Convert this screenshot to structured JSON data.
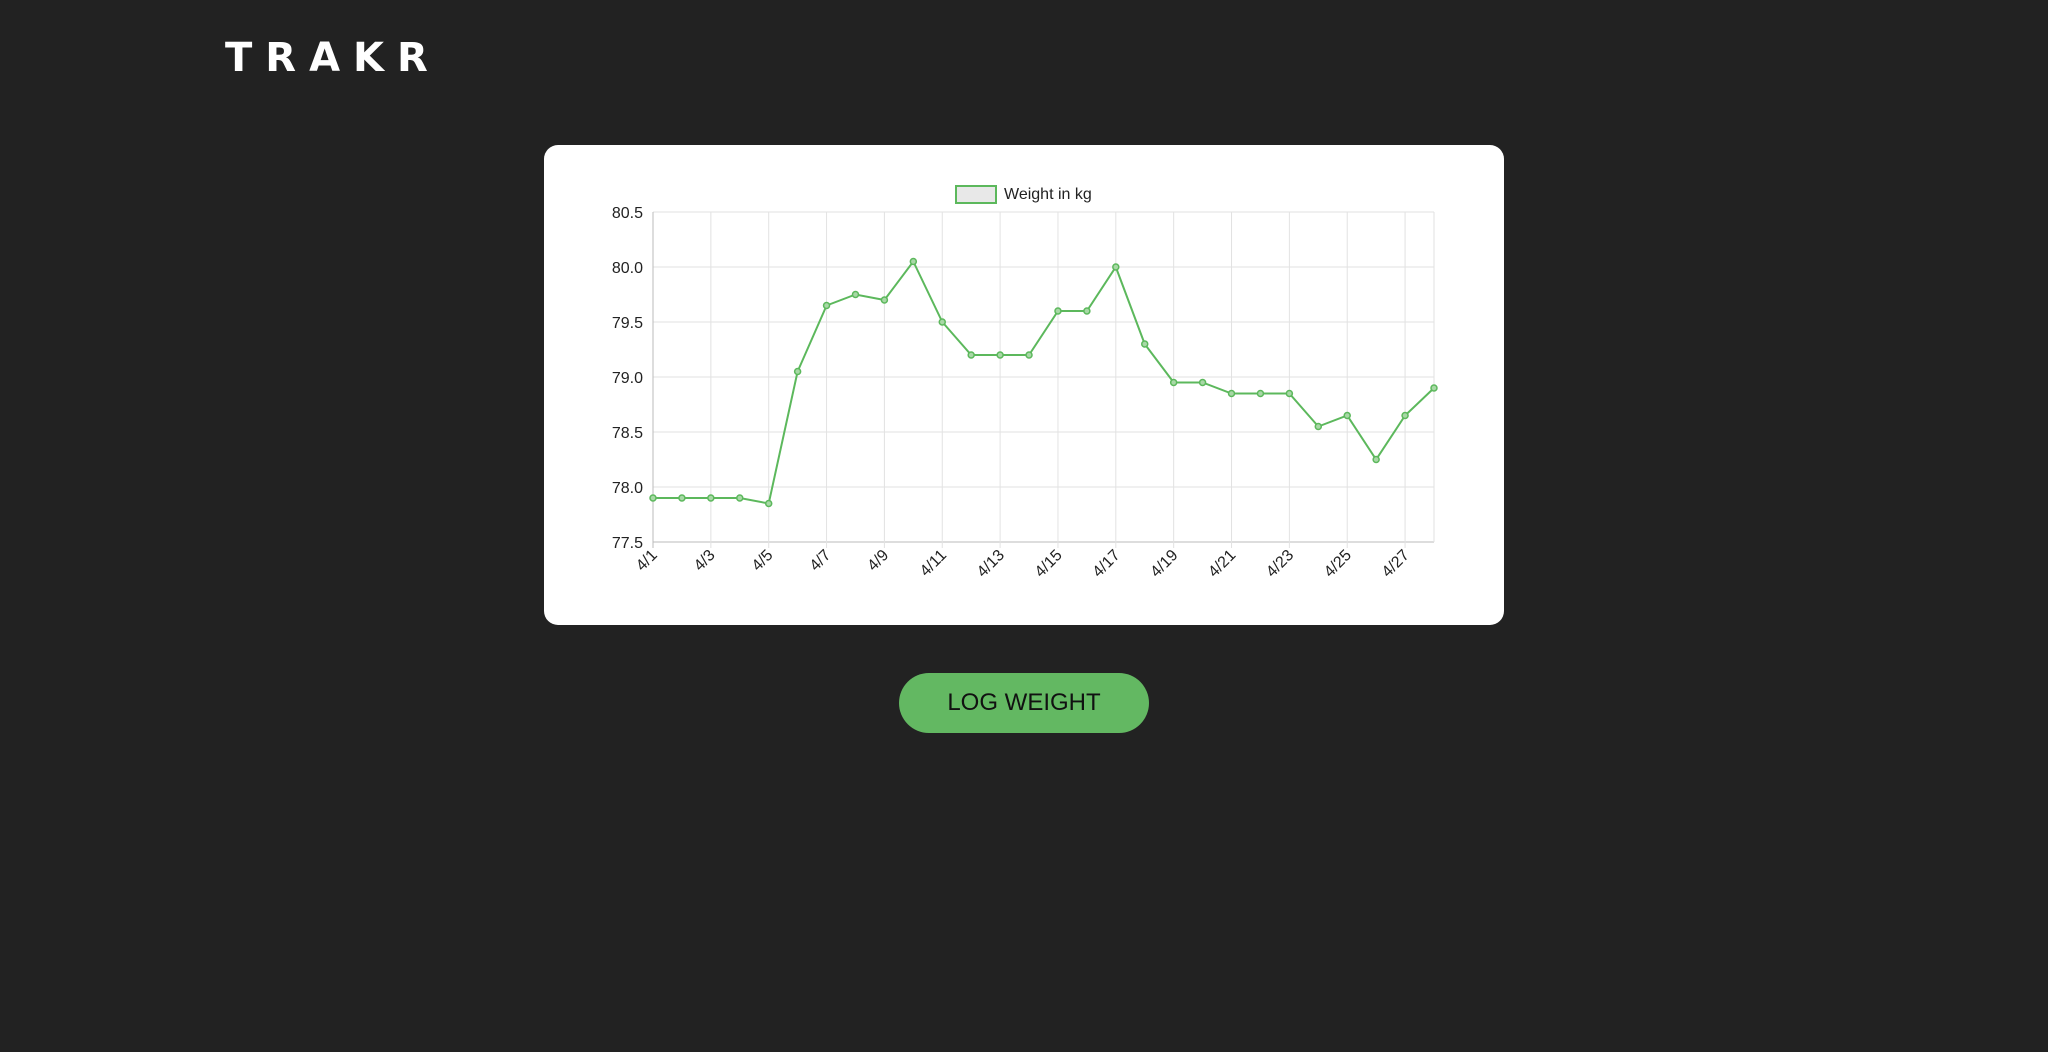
{
  "header": {
    "logo": "TRAKR"
  },
  "actions": {
    "log_weight_label": "LOG WEIGHT"
  },
  "colors": {
    "background": "#222222",
    "accent": "#63b862",
    "line": "#5cb85c",
    "card": "#ffffff"
  },
  "chart_data": {
    "type": "line",
    "legend": "Weight in kg",
    "legend_position": "top-center",
    "grid": true,
    "categories": [
      "4/1",
      "4/2",
      "4/3",
      "4/4",
      "4/5",
      "4/6",
      "4/7",
      "4/8",
      "4/9",
      "4/10",
      "4/11",
      "4/12",
      "4/13",
      "4/14",
      "4/15",
      "4/16",
      "4/17",
      "4/18",
      "4/19",
      "4/20",
      "4/21",
      "4/22",
      "4/23",
      "4/24",
      "4/25",
      "4/26",
      "4/27",
      "4/28"
    ],
    "x_tick_labels": [
      "4/1",
      "4/3",
      "4/5",
      "4/7",
      "4/9",
      "4/11",
      "4/13",
      "4/15",
      "4/17",
      "4/19",
      "4/21",
      "4/23",
      "4/25",
      "4/27"
    ],
    "series": [
      {
        "name": "Weight in kg",
        "values": [
          77.9,
          77.9,
          77.9,
          77.9,
          77.85,
          79.05,
          79.65,
          79.75,
          79.7,
          80.05,
          79.5,
          79.2,
          79.2,
          79.2,
          79.6,
          79.6,
          80.0,
          79.3,
          78.95,
          78.95,
          78.85,
          78.85,
          78.85,
          78.55,
          78.65,
          78.25,
          78.65,
          78.9
        ]
      }
    ],
    "ylim": [
      77.5,
      80.5
    ],
    "y_ticks": [
      "77.5",
      "78.0",
      "78.5",
      "79.0",
      "79.5",
      "80.0",
      "80.5"
    ]
  }
}
